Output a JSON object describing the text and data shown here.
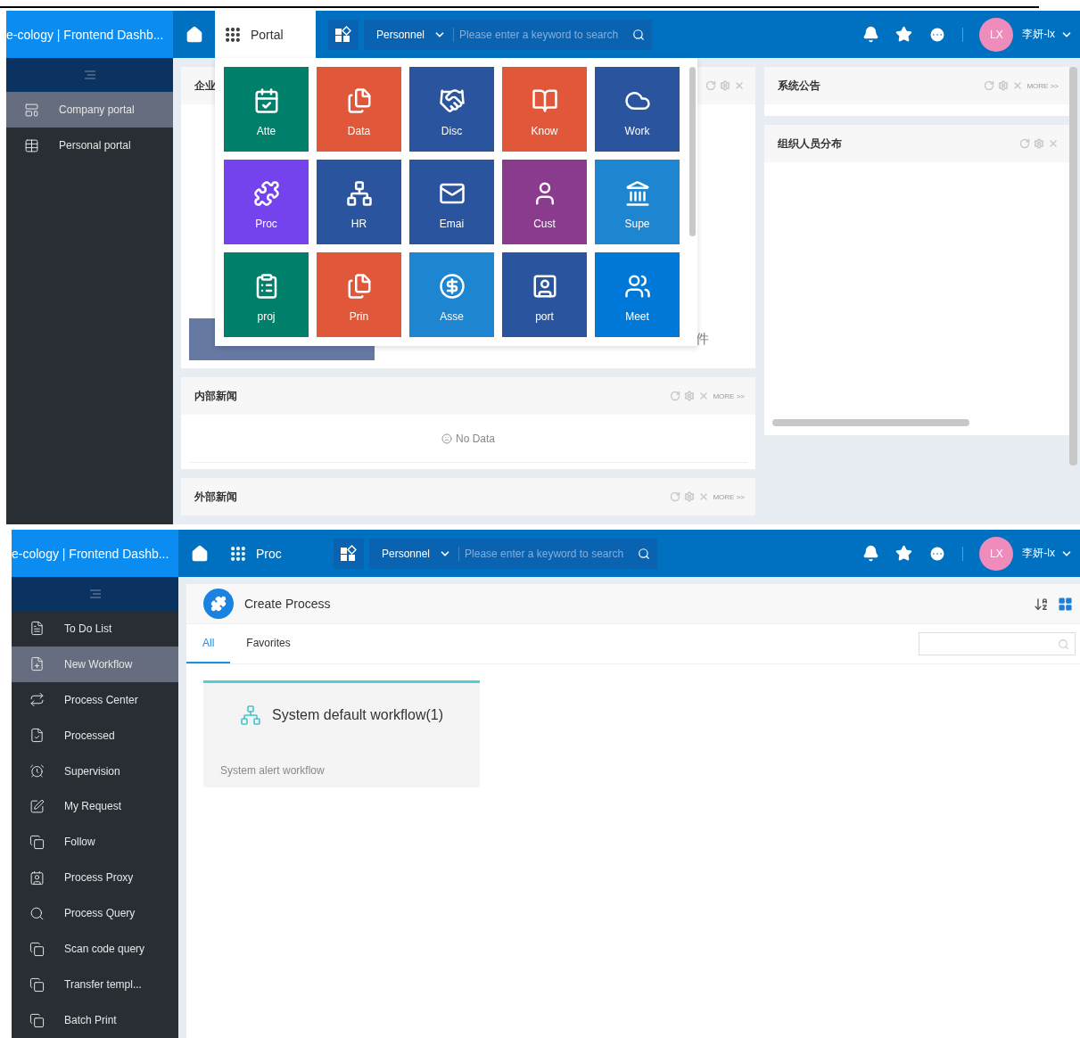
{
  "portal_screen": {
    "header": {
      "brand": "e-cology | Frontend Dashb...",
      "nav_label": "Portal",
      "menu_open": true,
      "scope": "Personnel",
      "search_placeholder": "Please enter a keyword to search",
      "avatar": "LX",
      "user": "李妍-lx"
    },
    "sidebar": {
      "items": [
        {
          "label": "Company portal",
          "selected": true
        },
        {
          "label": "Personal portal",
          "selected": false
        }
      ]
    },
    "left_panels": [
      {
        "title": "企业",
        "kind": "covered",
        "text": "件"
      },
      {
        "title": "内部新闻",
        "kind": "empty",
        "more": "MORE >>",
        "text": "No Data"
      },
      {
        "title": "外部新闻",
        "kind": "collapsed",
        "more": "MORE >>"
      }
    ],
    "right_panels": [
      {
        "title": "系统公告",
        "kind": "short",
        "more": "MORE >>"
      },
      {
        "title": "组织人员分布",
        "kind": "tall"
      }
    ],
    "menu_tiles": [
      {
        "label": "Atte",
        "color": "#00806b"
      },
      {
        "label": "Data",
        "color": "#e0573a"
      },
      {
        "label": "Disc",
        "color": "#2a559e"
      },
      {
        "label": "Know",
        "color": "#e0573a"
      },
      {
        "label": "Work",
        "color": "#2a559e"
      },
      {
        "label": "Proc",
        "color": "#7443ee"
      },
      {
        "label": "HR",
        "color": "#2a559e"
      },
      {
        "label": "Emai",
        "color": "#2a559e"
      },
      {
        "label": "Cust",
        "color": "#8b3b8d"
      },
      {
        "label": "Supe",
        "color": "#1e86d0"
      },
      {
        "label": "proj",
        "color": "#00806b"
      },
      {
        "label": "Prin",
        "color": "#e0573a"
      },
      {
        "label": "Asse",
        "color": "#1e86d0"
      },
      {
        "label": "port",
        "color": "#2a559e"
      },
      {
        "label": "Meet",
        "color": "#0078d7"
      }
    ]
  },
  "workflow_screen": {
    "header": {
      "brand": "e-cology | Frontend Dashb...",
      "nav_label": "Proc",
      "menu_open": false,
      "scope": "Personnel",
      "search_placeholder": "Please enter a keyword to search",
      "avatar": "LX",
      "user": "李妍-lx"
    },
    "sidebar": {
      "items": [
        {
          "label": "To Do List",
          "selected": false
        },
        {
          "label": "New Workflow",
          "selected": true
        },
        {
          "label": "Process Center",
          "selected": false
        },
        {
          "label": "Processed",
          "selected": false
        },
        {
          "label": "Supervision",
          "selected": false
        },
        {
          "label": "My Request",
          "selected": false
        },
        {
          "label": "Follow",
          "selected": false
        },
        {
          "label": "Process Proxy",
          "selected": false
        },
        {
          "label": "Process Query",
          "selected": false
        },
        {
          "label": "Scan code query",
          "selected": false
        },
        {
          "label": "Transfer templ...",
          "selected": false
        },
        {
          "label": "Batch Print",
          "selected": false
        }
      ]
    },
    "title": "Create Process",
    "tabs": [
      {
        "label": "All",
        "selected": true
      },
      {
        "label": "Favorites",
        "selected": false
      }
    ],
    "cards": [
      {
        "title": "System default workflow(1)",
        "subtitle": "System alert workflow"
      }
    ]
  }
}
